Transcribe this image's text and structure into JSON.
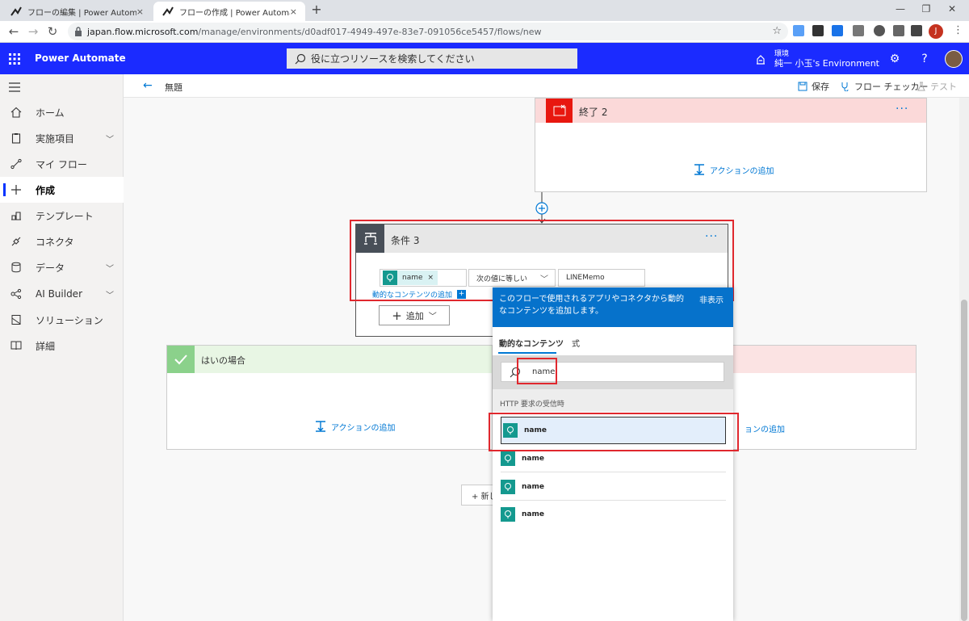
{
  "browser": {
    "tabs": [
      {
        "title": "フローの編集 | Power Automate",
        "close": "×"
      },
      {
        "title": "フローの作成 | Power Automate",
        "close": "×"
      }
    ],
    "new_tab": "+",
    "url_host": "japan.flow.microsoft.com",
    "url_path": "/manage/environments/d0adf017-4949-497e-83e7-091056ce5457/flows/new",
    "profile_initial": "J"
  },
  "header": {
    "app_name": "Power Automate",
    "search_placeholder": "役に立つリソースを検索してください",
    "env_label": "環境",
    "env_name": "純一 小玉's Environment"
  },
  "sidebar": {
    "items": [
      {
        "label": "ホーム"
      },
      {
        "label": "実施項目"
      },
      {
        "label": "マイ フロー"
      },
      {
        "label": "作成"
      },
      {
        "label": "テンプレート"
      },
      {
        "label": "コネクタ"
      },
      {
        "label": "データ"
      },
      {
        "label": "AI Builder"
      },
      {
        "label": "ソリューション"
      },
      {
        "label": "詳細"
      }
    ]
  },
  "commandbar": {
    "flow_title": "無題",
    "save": "保存",
    "checker": "フロー チェッカー",
    "test": "テスト"
  },
  "canvas": {
    "end_card_title": "終了 2",
    "add_action": "アクションの追加",
    "condition_title": "条件 3",
    "token_name": "name",
    "token_remove": "×",
    "operator": "次の値に等しい",
    "compare_value": "LINEMemo",
    "dynamic_add": "動的なコンテンツの追加",
    "add_button": "追加",
    "yes_branch": "はいの場合",
    "new_step_partial": "+ 新し",
    "no_branch_add_partial": "ョンの追加"
  },
  "popup": {
    "banner_text": "このフローで使用されるアプリやコネクタから動的なコンテンツを追加します。",
    "hide": "非表示",
    "tab_dynamic": "動的なコンテンツ",
    "tab_expression": "式",
    "search_value": "name",
    "section": "HTTP 要求の受信時",
    "items": [
      {
        "label": "name"
      },
      {
        "label": "name"
      },
      {
        "label": "name"
      },
      {
        "label": "name"
      }
    ]
  },
  "colors": {
    "header_blue": "#1b2bff",
    "accent_blue": "#0078d4",
    "highlight_red": "#e0282e",
    "yes_green": "#8bd18b",
    "end_red": "#e8170f"
  }
}
